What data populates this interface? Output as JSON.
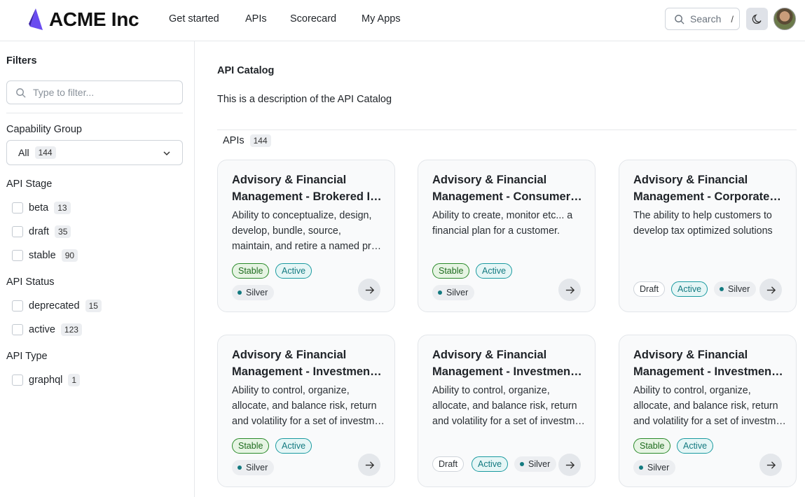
{
  "header": {
    "brand": "ACME Inc",
    "nav": [
      "Get started",
      "APIs",
      "Scorecard",
      "My Apps"
    ],
    "search_label": "Search",
    "search_shortcut": "/"
  },
  "sidebar": {
    "title": "Filters",
    "filter_placeholder": "Type to filter...",
    "capability_group": {
      "label": "Capability Group",
      "selected": "All",
      "count": "144"
    },
    "api_stage": {
      "label": "API Stage",
      "options": [
        {
          "label": "beta",
          "count": "13"
        },
        {
          "label": "draft",
          "count": "35"
        },
        {
          "label": "stable",
          "count": "90"
        }
      ]
    },
    "api_status": {
      "label": "API Status",
      "options": [
        {
          "label": "deprecated",
          "count": "15"
        },
        {
          "label": "active",
          "count": "123"
        }
      ]
    },
    "api_type": {
      "label": "API Type",
      "options": [
        {
          "label": "graphql",
          "count": "1"
        }
      ]
    }
  },
  "main": {
    "title": "API Catalog",
    "description": "This is a description of the API Catalog",
    "apis_label": "APIs",
    "apis_count": "144",
    "cards": [
      {
        "title1": "Advisory & Financial",
        "title2": "Management - Brokered Investment",
        "desc": [
          "Ability to conceptualize, design,",
          "develop, bundle, source,",
          "maintain, and retire a named product"
        ],
        "stage": "Stable",
        "status": "Active",
        "tier": "Silver"
      },
      {
        "title1": "Advisory & Financial",
        "title2": "Management - Consumer Planning",
        "desc": [
          "Ability to create, monitor etc... a",
          "financial plan for a customer."
        ],
        "stage": "Stable",
        "status": "Active",
        "tier": "Silver"
      },
      {
        "title1": "Advisory & Financial",
        "title2": "Management - Corporate Tax",
        "desc": [
          "The ability to help customers to",
          "develop tax optimized solutions"
        ],
        "stage": "Draft",
        "status": "Active",
        "tier": "Silver"
      },
      {
        "title1": "Advisory & Financial",
        "title2": "Management - Investment Portfolio",
        "desc": [
          "Ability to control, organize,",
          "allocate, and balance risk, return",
          "and volatility for a set of investments"
        ],
        "stage": "Stable",
        "status": "Active",
        "tier": "Silver"
      },
      {
        "title1": "Advisory & Financial",
        "title2": "Management - Investment Analysis",
        "desc": [
          "Ability to control, organize,",
          "allocate, and balance risk, return",
          "and volatility for a set of investments"
        ],
        "stage": "Draft",
        "status": "Active",
        "tier": "Silver"
      },
      {
        "title1": "Advisory & Financial",
        "title2": "Management - Investment Strategy",
        "desc": [
          "Ability to control, organize,",
          "allocate, and balance risk, return",
          "and volatility for a set of investments"
        ],
        "stage": "Stable",
        "status": "Active",
        "tier": "Silver"
      }
    ]
  },
  "colors": {
    "brand_logo": "#5b3fd6",
    "stable": "#2a8a2a",
    "active": "#1a9aa0"
  },
  "icons": [
    "acme-logo-icon",
    "search-icon",
    "moon-icon",
    "chevron-down-icon",
    "arrow-right-icon"
  ]
}
